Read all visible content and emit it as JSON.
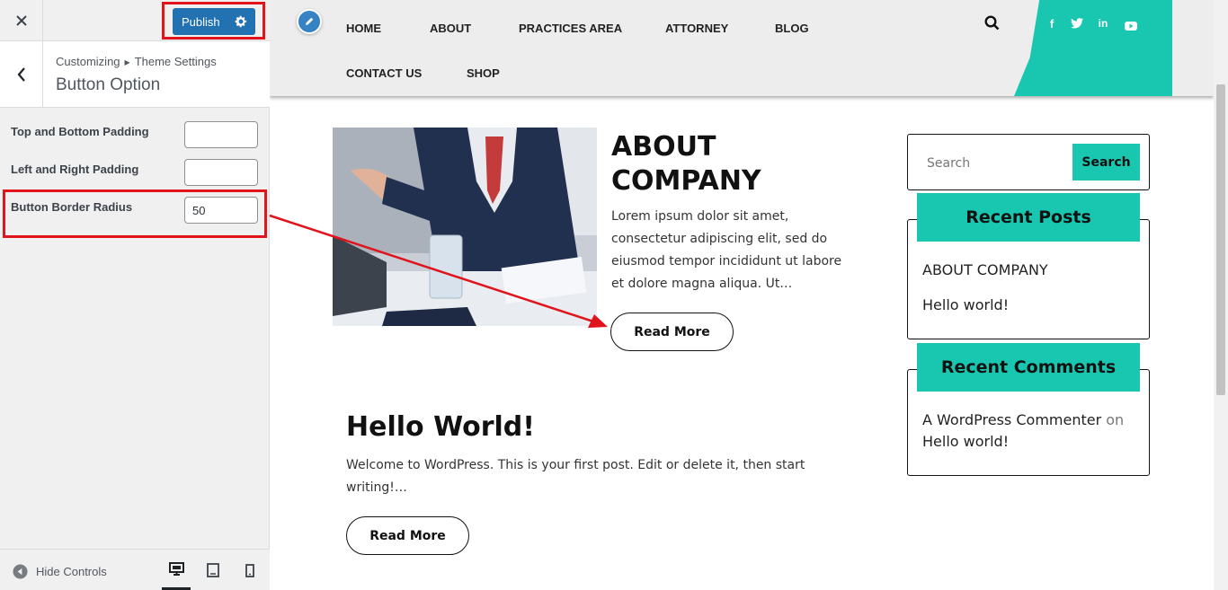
{
  "customizer": {
    "publish_label": "Publish",
    "breadcrumb": {
      "root": "Customizing",
      "parent": "Theme Settings"
    },
    "section_title": "Button Option",
    "controls": [
      {
        "label": "Top and Bottom Padding",
        "value": ""
      },
      {
        "label": "Left and Right Padding",
        "value": ""
      },
      {
        "label": "Button Border Radius",
        "value": "50"
      }
    ],
    "footer": {
      "hide_controls_label": "Hide Controls"
    }
  },
  "site": {
    "nav": [
      "HOME",
      "ABOUT",
      "PRACTICES AREA",
      "ATTORNEY",
      "BLOG",
      "CONTACT US",
      "SHOP"
    ],
    "social_icons": [
      "facebook-icon",
      "twitter-icon",
      "linkedin-icon",
      "youtube-icon"
    ],
    "accent_color": "#19c7b1",
    "posts": [
      {
        "title_line1": "ABOUT",
        "title_line2": "COMPANY",
        "excerpt": "Lorem ipsum dolor sit amet, consectetur adipiscing elit, sed do eiusmod tempor incididunt ut labore et dolore magna aliqua. Ut…",
        "button": "Read More"
      },
      {
        "title": "Hello World!",
        "excerpt": "Welcome to WordPress. This is your first post. Edit or delete it, then start writing!…",
        "button": "Read More"
      }
    ],
    "sidebar": {
      "search_placeholder": "Search",
      "search_button": "Search",
      "recent_posts_title": "Recent Posts",
      "recent_posts": [
        "ABOUT COMPANY",
        "Hello world!"
      ],
      "recent_comments_title": "Recent Comments",
      "comment_author": "A WordPress Commenter",
      "comment_on": "on",
      "comment_post": "Hello world!"
    }
  },
  "annotation_color": "#e0141c"
}
